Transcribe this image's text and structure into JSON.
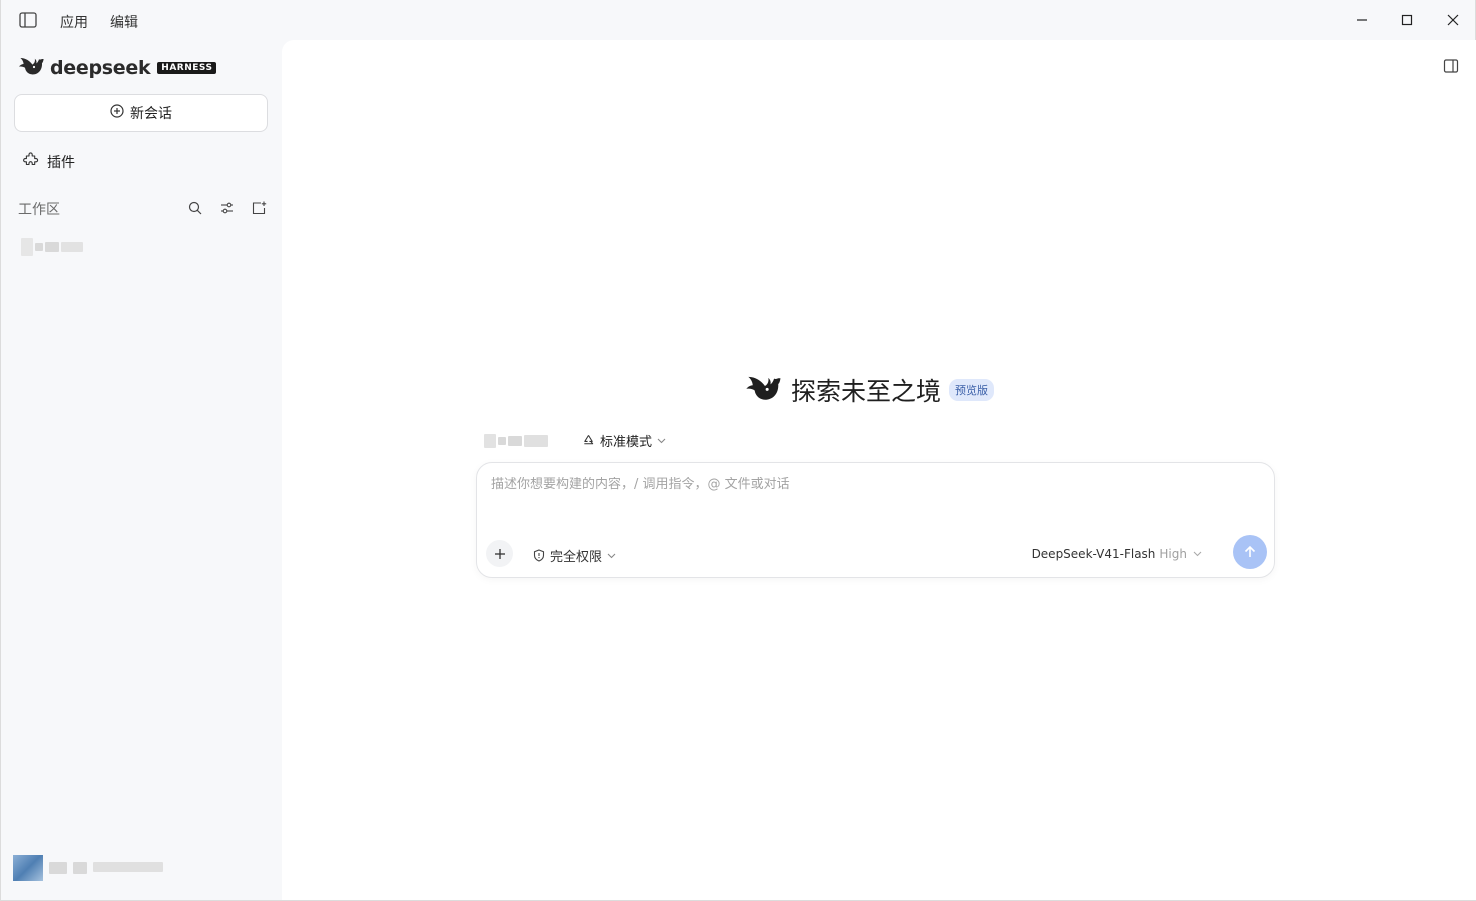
{
  "titlebar": {
    "menu": [
      "应用",
      "编辑"
    ]
  },
  "sidebar": {
    "logo_text": "deepseek",
    "logo_badge": "HARNESS",
    "new_chat_label": "新会话",
    "plugins_label": "插件",
    "workspace_title": "工作区"
  },
  "main": {
    "hero_title": "探索未至之境",
    "hero_badge": "预览版",
    "mode_label": "标准模式",
    "composer": {
      "placeholder": "描述你想要构建的内容，/ 调用指令，@ 文件或对话",
      "permission_label": "完全权限",
      "model_name": "DeepSeek-V41-Flash",
      "model_effort": "High"
    }
  },
  "colors": {
    "send_button": "#a9c3f6",
    "badge_bg": "#dfe8fb",
    "sidebar_bg": "#f7f8fa"
  }
}
